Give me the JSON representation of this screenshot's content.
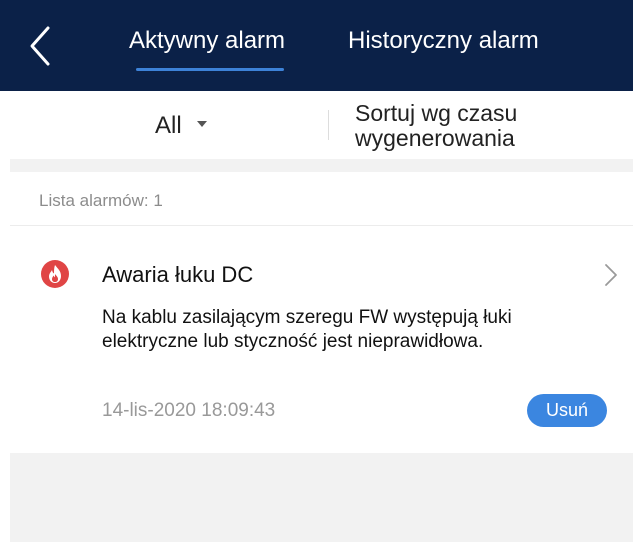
{
  "header": {
    "back_icon": "chevron-left-icon",
    "tabs": [
      {
        "label": "Aktywny alarm",
        "active": true
      },
      {
        "label": "Historyczny alarm",
        "active": false
      }
    ],
    "background_color": "#0b2148",
    "accent_color": "#3d82d8"
  },
  "filter": {
    "selected": "All",
    "sort_label": "Sortuj wg czasu wygenerowania"
  },
  "list": {
    "count_label": "Lista alarmów: 1",
    "alarms": [
      {
        "icon": "fire-icon",
        "icon_color": "#e04545",
        "title": "Awaria łuku DC",
        "description": "Na kablu zasilającym szeregu FW występują łuki elektryczne lub styczność jest nieprawidłowa.",
        "timestamp": "14-lis-2020 18:09:43",
        "delete_label": "Usuń"
      }
    ]
  }
}
